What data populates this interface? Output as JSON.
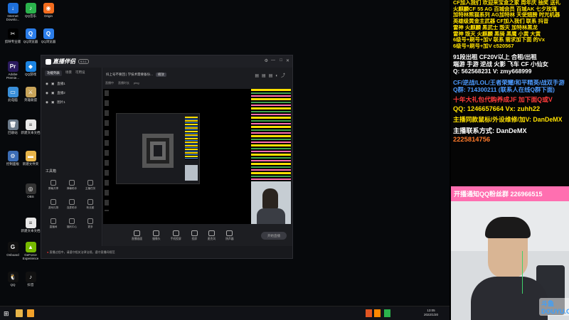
{
  "desktop_icons": [
    {
      "label": "Internet Downlo...",
      "icon": "download-icon",
      "color": "#1e6fd9",
      "glyph": "↓"
    },
    {
      "label": "QQ音乐",
      "icon": "qq-music-icon",
      "color": "#2bb24c",
      "glyph": "♪"
    },
    {
      "label": "Origin",
      "icon": "origin-icon",
      "color": "#f26c1e",
      "glyph": "◉"
    },
    {
      "label": "剪映专业版",
      "icon": "capcut-icon",
      "color": "#000000",
      "glyph": "✂"
    },
    {
      "label": "QQ浏览器",
      "icon": "qq-browser-icon",
      "color": "#2b7de9",
      "glyph": "Q"
    },
    {
      "label": "QQ浏览器",
      "icon": "qq-browser-icon-2",
      "color": "#2b7de9",
      "glyph": "Q"
    },
    {
      "label": "Adobe Premie...",
      "icon": "premiere-icon",
      "color": "#2a1a5e",
      "glyph": "Pr"
    },
    {
      "label": "QQ游戏",
      "icon": "qq-game-icon",
      "color": "#1b84e2",
      "glyph": "◆"
    },
    {
      "label": "此电脑",
      "icon": "computer-icon",
      "color": "#3a8fd9",
      "glyph": "▭"
    },
    {
      "label": "英雄联盟",
      "icon": "lol-icon",
      "color": "#c8a45a",
      "glyph": "⚔"
    },
    {
      "label": "回收站",
      "icon": "recycle-bin-icon",
      "color": "#6b7a8a",
      "glyph": "🗑"
    },
    {
      "label": "新建文本文档",
      "icon": "text-file-icon",
      "color": "#e8e8e8",
      "glyph": "≡"
    },
    {
      "label": "控制面板",
      "icon": "control-panel-icon",
      "color": "#3c6db5",
      "glyph": "⚙"
    },
    {
      "label": "新建文件夹",
      "icon": "folder-icon",
      "color": "#e8b54a",
      "glyph": "▬"
    },
    {
      "label": "OBS",
      "icon": "obs-icon",
      "color": "#333333",
      "glyph": "◎"
    },
    {
      "label": "新建文本文档",
      "icon": "text-file-icon-2",
      "color": "#e8e8e8",
      "glyph": "≡"
    },
    {
      "label": "Onboard",
      "icon": "logitech-icon",
      "color": "#111111",
      "glyph": "G"
    },
    {
      "label": "GeForce Experience",
      "icon": "nvidia-icon",
      "color": "#76b900",
      "glyph": "▲"
    },
    {
      "label": "QQ",
      "icon": "qq-icon",
      "color": "#111111",
      "glyph": "🐧"
    },
    {
      "label": "抖音",
      "icon": "douyin-icon",
      "color": "#111111",
      "glyph": "♪"
    }
  ],
  "app": {
    "name": "直播伴侣",
    "version_badge": "9.5.1",
    "tabs": [
      "功能列表",
      "场景",
      "可用设"
    ],
    "scenes": [
      "直播1",
      "直播2",
      "图片1"
    ],
    "tools_title": "工具箱",
    "tools": [
      "屏幕共享",
      "弹幕助手",
      "主播任务",
      "游戏礼物",
      "连麦助手",
      "粉丝团",
      "直播间",
      "福利中心",
      "更多"
    ],
    "preview_title": "抖上号不要回 | 学技术需要备份...",
    "preview_badge": "播放",
    "preview_status": [
      "直播中",
      "直播时长",
      "ping"
    ],
    "bottom_tools": [
      "直播画面",
      "摄像头",
      "手机投屏",
      "投屏",
      "麦克风",
      "扬声器"
    ],
    "go_live": "开始直播",
    "status_text": "直播过程中，请遵守相关法律法规，遵守直播间规范"
  },
  "overlay_lines": [
    {
      "text": "CF加入我们  欢迎来宝盒之家 周年庆 抽奖  送礼",
      "color": "#ffe100",
      "bg": "transparent"
    },
    {
      "text": "火麒麟CF 55 AG 百城会员 百城AK 七夕玫瑰",
      "color": "#ffe100",
      "bg": "transparent"
    },
    {
      "text": "加特林熊猫系列 AG加特林 天使翅膀 时光机器",
      "color": "#ffe100",
      "bg": "transparent"
    },
    {
      "text": "英雄级黄金主武器 CF加入我们 联系 抖音",
      "color": "#ffe100",
      "bg": "transparent"
    },
    {
      "text": "雷神 火麒麟 黑武士 毁灭 加特林黑龙",
      "color": "#ffe100",
      "bg": "transparent"
    },
    {
      "text": "雷神 毁灭 火麒麟 黑骑 黑鹰 小黄 大黄",
      "color": "#ffe100",
      "bg": "transparent"
    },
    {
      "text": "6级号+刷号+加V 联系 需求加下面 的Vx",
      "color": "#ffe100",
      "bg": "transparent"
    },
    {
      "text": "6级号+刷号+加V  c520567",
      "color": "#ffe100",
      "bg": "transparent"
    },
    {
      "text": "91段出租 CF20V以上   合租/出租",
      "color": "#ffffff",
      "bg": "transparent"
    },
    {
      "text": "端游 手游 逆战 火影 飞车 CF 小仙女",
      "color": "#ffffff",
      "bg": "transparent"
    },
    {
      "text": "Q: 562568231  V: zmy668999",
      "color": "#ffffff",
      "bg": "transparent"
    },
    {
      "text": "CF/逆战/LOL/王者荣耀/和平精英/战双手游",
      "color": "#4d9bff",
      "bg": "transparent"
    },
    {
      "text": "Q群: 714300211  (联系人在线Q群下面)",
      "color": "#4d9bff",
      "bg": "transparent"
    },
    {
      "text": "十年大礼包代购养成JF 加下面Q或V",
      "color": "#ff3b3b",
      "bg": "transparent"
    },
    {
      "text": "QQ: 1246657664  Vx: zuhh22",
      "color": "#ffe100",
      "bg": "transparent"
    },
    {
      "text": "主播同款鼠标/外设维修/加V: DanDeMX",
      "color": "#ffe100",
      "bg": "transparent"
    },
    {
      "text": "主播联系方式: DanDeMX",
      "color": "#ffffff",
      "bg": "transparent"
    },
    {
      "text": "2225814756",
      "color": "#ff7a2a",
      "bg": "transparent"
    },
    {
      "text": "开播通知QQ粉丝群   226966515",
      "color": "#ffffff",
      "bg": "#ff6fb0"
    }
  ],
  "taskbar": {
    "time": "13:05",
    "date": "2022/1/20"
  },
  "watermark": "斗鱼 DOUYU.COM"
}
